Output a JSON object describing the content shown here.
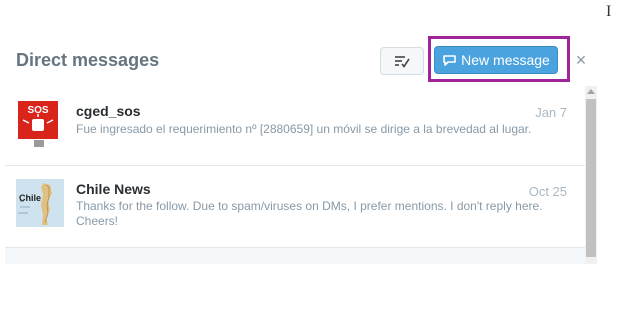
{
  "text_cursor": "I",
  "header": {
    "title": "Direct messages",
    "new_message_label": "New message",
    "close_glyph": "×"
  },
  "conversations": [
    {
      "name": "cged_sos",
      "date": "Jan 7",
      "snippet": "Fue ingresado el requerimiento nº [2880659] un móvil se dirige a la brevedad al lugar.",
      "avatar_text": "SOS",
      "avatar_color": "#d9241c"
    },
    {
      "name": "Chile News",
      "date": "Oct 25",
      "snippet": "Thanks for the follow. Due to spam/viruses on DMs, I prefer mentions. I don't reply here. Cheers!",
      "avatar_text": "Chile",
      "avatar_color": "#cfe3ef"
    }
  ],
  "colors": {
    "accent": "#4aa3df",
    "highlight": "#a0239a",
    "muted_text": "#8899a6"
  },
  "icons": [
    "mark-all-read-icon",
    "new-message-icon",
    "close-icon"
  ]
}
